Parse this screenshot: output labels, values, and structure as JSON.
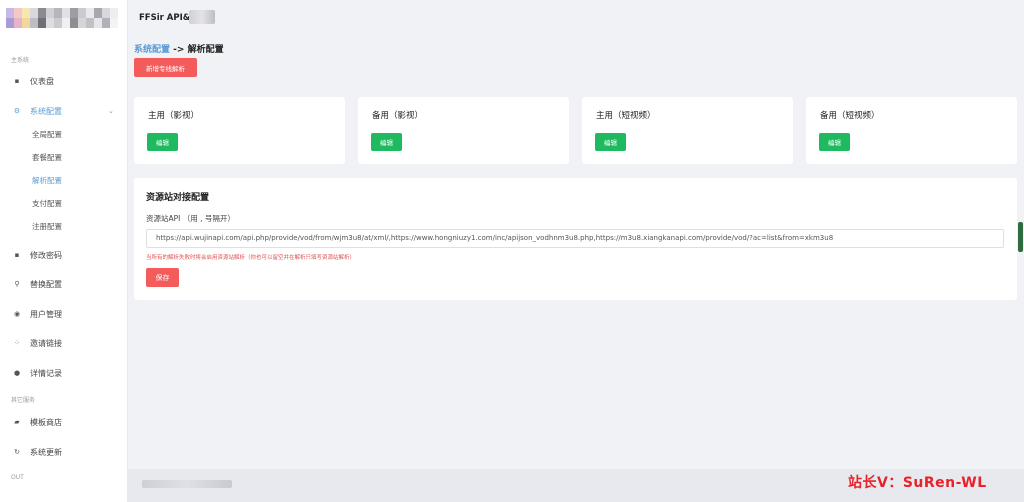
{
  "app": {
    "title": "FFSir API&"
  },
  "sidebar": {
    "section_main": "主系统",
    "section_other": "其它服务",
    "section_out": "OUT",
    "items": [
      {
        "label": "仪表盘",
        "icon": "dashboard-icon"
      },
      {
        "label": "系统配置",
        "icon": "gear-icon"
      },
      {
        "label": "修改密码",
        "icon": "key-icon"
      },
      {
        "label": "替换配置",
        "icon": "search-icon"
      },
      {
        "label": "用户管理",
        "icon": "user-icon"
      },
      {
        "label": "邀请链接",
        "icon": "invite-icon"
      },
      {
        "label": "详情记录",
        "icon": "dot-icon"
      },
      {
        "label": "模板商店",
        "icon": "shop-icon"
      },
      {
        "label": "系统更新",
        "icon": "refresh-icon"
      }
    ],
    "subitems": [
      {
        "label": "全局配置"
      },
      {
        "label": "套餐配置"
      },
      {
        "label": "解析配置"
      },
      {
        "label": "支付配置"
      },
      {
        "label": "注册配置"
      }
    ]
  },
  "breadcrumb": {
    "parent": "系统配置",
    "arrow": " -> ",
    "current": "解析配置"
  },
  "buttons": {
    "add_parse": "新增专线解析",
    "save": "保存"
  },
  "cards": [
    {
      "title": "主用（影视）",
      "button": "编辑"
    },
    {
      "title": "备用（影视）",
      "button": "编辑"
    },
    {
      "title": "主用（短视频）",
      "button": "编辑"
    },
    {
      "title": "备用（短视频）",
      "button": "编辑"
    }
  ],
  "config": {
    "title": "资源站对接配置",
    "field_label": "资源站API （用 , 号隔开）",
    "api_value": "https://api.wujinapi.com/api.php/provide/vod/from/wjm3u8/at/xml/,https://www.hongniuzy1.com/inc/apijson_vodhnm3u8.php,https://m3u8.xiangkanapi.com/provide/vod/?ac=list&from=xkm3u8",
    "hint": "当所有的解析失败时将会启用资源站解析（你也可以留空并在解析只填写资源站解析）"
  },
  "watermark": "站长V：SuRen-WL",
  "colors": {
    "accent": "#5b9bd5",
    "danger": "#f45c5c",
    "success": "#1fb960"
  }
}
